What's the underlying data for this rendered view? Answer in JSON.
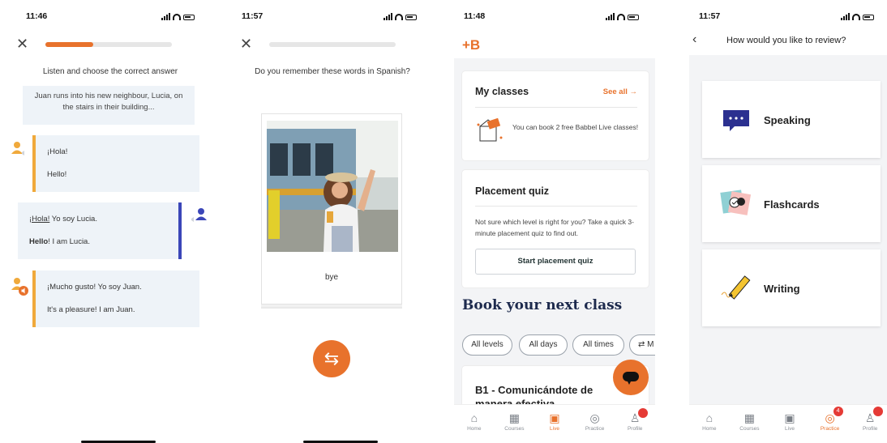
{
  "screens": [
    {
      "time": "11:46",
      "instruction": "Listen and choose the correct answer",
      "intro": "Juan runs into his new neighbour, Lucia, on the stairs in their building...",
      "progress": 0.38,
      "dialog": [
        {
          "l1": "¡Hola!",
          "l2": "Hello!"
        },
        {
          "l1a": "¡Hola!",
          "l1b": " Yo soy Lucia.",
          "l2a": "Hello",
          "l2b": "! I am Lucia."
        },
        {
          "l1": "¡Mucho gusto! Yo soy Juan.",
          "l2": "It's a pleasure! I am Juan."
        }
      ]
    },
    {
      "time": "11:57",
      "instruction": "Do you remember these words in Spanish?",
      "word": "bye"
    },
    {
      "time": "11:48",
      "logo": "+B",
      "my_classes": {
        "title": "My classes",
        "see_all": "See all →",
        "text": "You can book 2 free Babbel Live classes!"
      },
      "placement": {
        "title": "Placement quiz",
        "text": "Not sure which level is right for you? Take a quick 3-minute placement quiz to find out.",
        "button": "Start placement quiz"
      },
      "book_title": "Book your next class",
      "chips": [
        "All levels",
        "All days",
        "All times",
        "⇄ M"
      ],
      "class_title_1": "B1 - Comunicándote de",
      "class_title_2": "manera efectiva",
      "tabs": [
        "Home",
        "Courses",
        "Live",
        "Practice",
        "Profile"
      ]
    },
    {
      "time": "11:57",
      "header": "How would you like to review?",
      "options": [
        "Speaking",
        "Flashcards",
        "Writing"
      ],
      "practice_badge": "4",
      "tabs": [
        "Home",
        "Courses",
        "Live",
        "Practice",
        "Profile"
      ]
    }
  ],
  "colors": {
    "accent": "#e8722c",
    "blue": "#3b46b8",
    "yellow": "#f0a93b"
  }
}
